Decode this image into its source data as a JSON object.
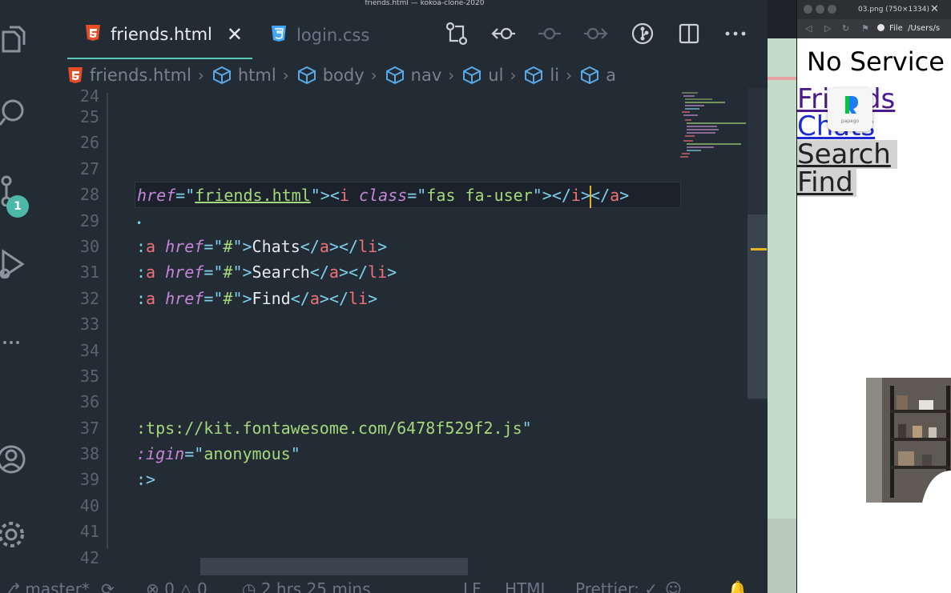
{
  "window": {
    "title": "friends.html — kokoa-clone-2020"
  },
  "activity_bar": {
    "scm_badge": "1"
  },
  "tabs": [
    {
      "label": "friends.html",
      "icon": "html5-icon",
      "active": true
    },
    {
      "label": "login.css",
      "icon": "css3-icon",
      "active": false
    }
  ],
  "breadcrumb": [
    "friends.html",
    "html",
    "body",
    "nav",
    "ul",
    "li",
    "a"
  ],
  "editor": {
    "line_numbers": [
      "24",
      "25",
      "26",
      "27",
      "28",
      "29",
      "30",
      "31",
      "32",
      "33",
      "34",
      "35",
      "36",
      "37",
      "38",
      "39",
      "40",
      "41",
      "42"
    ],
    "line28": {
      "attr": "href",
      "eq": "=\"",
      "href": "friends.html",
      "close_open": "\"><",
      "tag_i": "i",
      "attr_class": "class",
      "class_val": "fas fa-user",
      "close_i": "\"></",
      "tag_i2": "i",
      "gt": ">",
      "lt": "<",
      "slash": "/",
      "tag_a": "a",
      "gt2": ">"
    },
    "line29": "•",
    "line30": {
      "tag": "a",
      "attr": "href",
      "eq": "=\"",
      "val": "#",
      "gt": "\">",
      "text": "Chats",
      "close": "</",
      "tag2": "a",
      "mid": "></",
      "tag3": "li",
      "end": ">"
    },
    "line31": {
      "tag": "a",
      "attr": "href",
      "eq": "=\"",
      "val": "#",
      "gt": "\">",
      "text": "Search",
      "close": "</",
      "tag2": "a",
      "mid": "></",
      "tag3": "li",
      "end": ">"
    },
    "line32": {
      "tag": "a",
      "attr": "href",
      "eq": "=\"",
      "val": "#",
      "gt": "\">",
      "text": "Find",
      "close": "</",
      "tag2": "a",
      "mid": "></",
      "tag3": "li",
      "end": ">"
    },
    "line37": {
      "val": ":tps://kit.fontawesome.com/6478f529f2.js",
      "end": "\""
    },
    "line38": {
      "attr": ":igin",
      "eq": "=\"",
      "val": "anonymous",
      "end": "\""
    },
    "line39": ":>"
  },
  "status_bar": {
    "branch": "master*",
    "errors": "0",
    "warnings": "0",
    "time": "2 hrs 25 mins",
    "eol": "LF",
    "language": "HTML",
    "formatter": "Prettier: ✓"
  },
  "browser": {
    "tab_title": "03.png (750×1334)",
    "url_scheme": "File",
    "url_path": "/Users/s",
    "heading": "No Service",
    "links": [
      "Friends",
      "Chats",
      "Search",
      "Find"
    ],
    "extension_label": "papago"
  },
  "colors": {
    "editor_bg": "#232b35",
    "accent": "#56c8b5",
    "cursor": "#e6b422",
    "badge": "#4db8a7"
  }
}
